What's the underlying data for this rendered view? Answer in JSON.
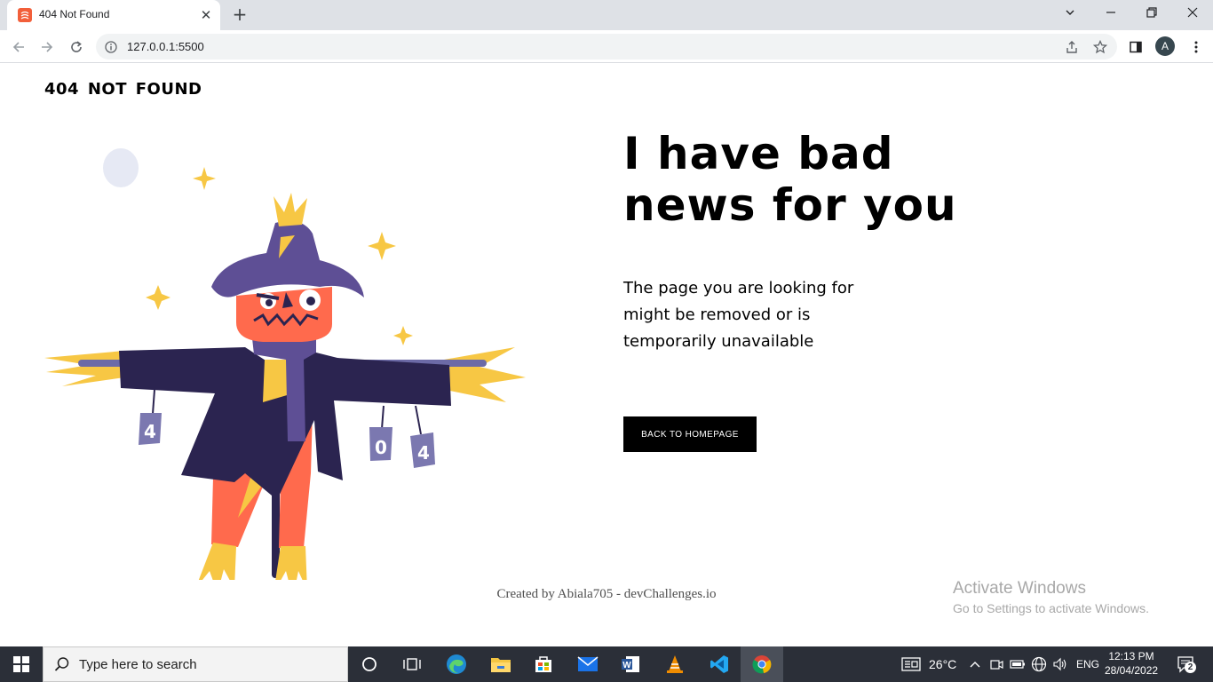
{
  "browser": {
    "tab_title": "404 Not Found",
    "tab_close": "✕",
    "new_tab": "+",
    "url": "127.0.0.1:5500",
    "profile_initial": "A",
    "window_controls": {
      "dropdown": "⌄",
      "minimize": "—",
      "restore": "❐",
      "close": "✕"
    }
  },
  "page": {
    "brand": "404 NOT FOUND",
    "headline": "I have bad news for you",
    "message": "The page you are looking for might be removed or is temporarily unavailable",
    "cta_label": "BACK TO HOMEPAGE",
    "footer": "Created by Abiala705 - devChallenges.io",
    "illustration": {
      "can_left": "4",
      "can_mid": "0",
      "can_right": "4"
    }
  },
  "watermark": {
    "title": "Activate Windows",
    "subtitle": "Go to Settings to activate Windows."
  },
  "taskbar": {
    "search_placeholder": "Type here to search",
    "weather": "26°C",
    "language": "ENG",
    "time": "12:13 PM",
    "date": "28/04/2022",
    "notifications": "2"
  },
  "colors": {
    "scarecrow_hat": "#5e4f95",
    "scarecrow_face": "#ff6a4d",
    "scarecrow_coat": "#2b2450",
    "straw": "#f7c744",
    "cta_background": "#000000"
  }
}
